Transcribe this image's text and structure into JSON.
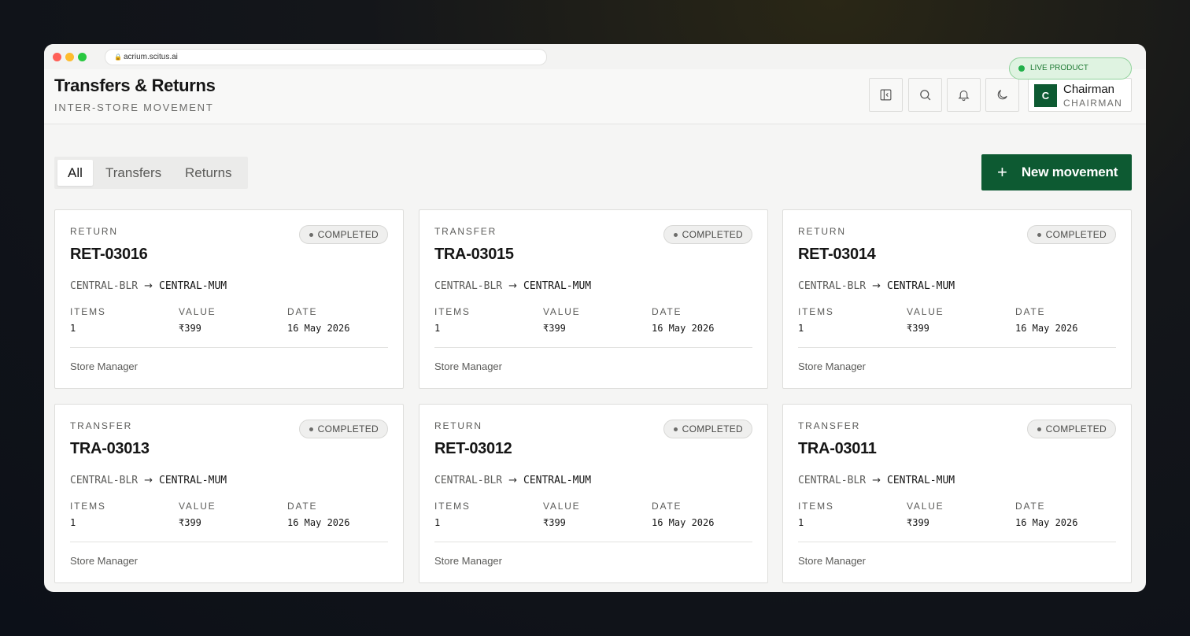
{
  "browser": {
    "url": "acrium.scitus.ai",
    "live_badge": "LIVE PRODUCT"
  },
  "header": {
    "title": "Transfers & Returns",
    "subtitle": "INTER-STORE MOVEMENT",
    "user": {
      "initial": "C",
      "name": "Chairman",
      "role": "CHAIRMAN"
    }
  },
  "toolbar": {
    "tabs": [
      {
        "label": "All",
        "active": true
      },
      {
        "label": "Transfers",
        "active": false
      },
      {
        "label": "Returns",
        "active": false
      }
    ],
    "new_button": "New movement"
  },
  "cards": [
    {
      "type": "RETURN",
      "id": "RET-03016",
      "status": "COMPLETED",
      "from": "CENTRAL-BLR",
      "to": "CENTRAL-MUM",
      "items_label": "ITEMS",
      "items": "1",
      "value_label": "VALUE",
      "value": "₹399",
      "date_label": "DATE",
      "date": "16 May 2026",
      "by": "Store Manager"
    },
    {
      "type": "TRANSFER",
      "id": "TRA-03015",
      "status": "COMPLETED",
      "from": "CENTRAL-BLR",
      "to": "CENTRAL-MUM",
      "items_label": "ITEMS",
      "items": "1",
      "value_label": "VALUE",
      "value": "₹399",
      "date_label": "DATE",
      "date": "16 May 2026",
      "by": "Store Manager"
    },
    {
      "type": "RETURN",
      "id": "RET-03014",
      "status": "COMPLETED",
      "from": "CENTRAL-BLR",
      "to": "CENTRAL-MUM",
      "items_label": "ITEMS",
      "items": "1",
      "value_label": "VALUE",
      "value": "₹399",
      "date_label": "DATE",
      "date": "16 May 2026",
      "by": "Store Manager"
    },
    {
      "type": "TRANSFER",
      "id": "TRA-03013",
      "status": "COMPLETED",
      "from": "CENTRAL-BLR",
      "to": "CENTRAL-MUM",
      "items_label": "ITEMS",
      "items": "1",
      "value_label": "VALUE",
      "value": "₹399",
      "date_label": "DATE",
      "date": "16 May 2026",
      "by": "Store Manager"
    },
    {
      "type": "RETURN",
      "id": "RET-03012",
      "status": "COMPLETED",
      "from": "CENTRAL-BLR",
      "to": "CENTRAL-MUM",
      "items_label": "ITEMS",
      "items": "1",
      "value_label": "VALUE",
      "value": "₹399",
      "date_label": "DATE",
      "date": "16 May 2026",
      "by": "Store Manager"
    },
    {
      "type": "TRANSFER",
      "id": "TRA-03011",
      "status": "COMPLETED",
      "from": "CENTRAL-BLR",
      "to": "CENTRAL-MUM",
      "items_label": "ITEMS",
      "items": "1",
      "value_label": "VALUE",
      "value": "₹399",
      "date_label": "DATE",
      "date": "16 May 2026",
      "by": "Store Manager"
    }
  ],
  "colors": {
    "brand": "#0d5a32",
    "live_green": "#22b04a"
  },
  "icons": [
    "collapse-sidebar-icon",
    "search-icon",
    "bell-icon",
    "moon-icon",
    "plus-icon",
    "arrow-right-icon"
  ]
}
